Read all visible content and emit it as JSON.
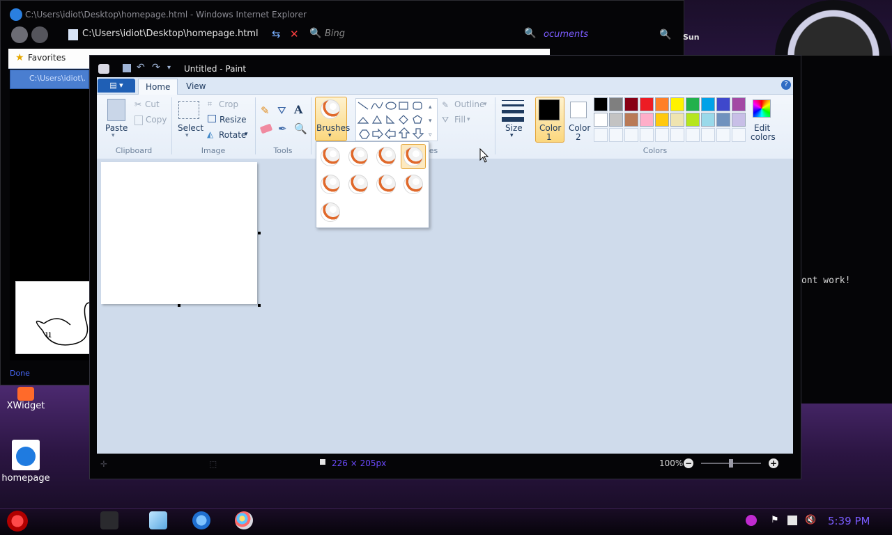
{
  "ie": {
    "title": "C:\\Users\\idiot\\Desktop\\homepage.html - Windows Internet Explorer",
    "address": "C:\\Users\\idiot\\Desktop\\homepage.html",
    "search_placeholder": "Bing",
    "favorites_label": "Favorites",
    "tab_label": "C:\\Users\\idiot\\...",
    "status": "Done"
  },
  "background_panel": {
    "documents_link": "ocuments",
    "day_label": "Sun",
    "terminal_text": "ont work!",
    "clock_ampm": "PM"
  },
  "desktop": {
    "icons": [
      {
        "label": "XWidget"
      },
      {
        "label": "homepage"
      }
    ]
  },
  "paint": {
    "title": "Untitled - Paint",
    "tabs": [
      {
        "label": "Home",
        "active": true
      },
      {
        "label": "View",
        "active": false
      }
    ],
    "clipboard": {
      "group": "Clipboard",
      "paste": "Paste",
      "cut": "Cut",
      "copy": "Copy"
    },
    "image": {
      "group": "Image",
      "select": "Select",
      "crop": "Crop",
      "resize": "Resize",
      "rotate": "Rotate"
    },
    "tools": {
      "group": "Tools"
    },
    "brushes": {
      "label": "Brushes"
    },
    "shapes": {
      "group_fragment": "es",
      "outline": "Outline",
      "fill": "Fill"
    },
    "size": {
      "label": "Size"
    },
    "color1": {
      "label": "Color",
      "num": "1"
    },
    "color2": {
      "label": "Color",
      "num": "2"
    },
    "colors": {
      "group": "Colors",
      "edit_label_1": "Edit",
      "edit_label_2": "colors",
      "row1": [
        "#000000",
        "#7f7f7f",
        "#880015",
        "#ed1c24",
        "#ff7f27",
        "#fff200",
        "#22b14c",
        "#00a2e8",
        "#3f48cc",
        "#a349a4"
      ],
      "row2": [
        "#ffffff",
        "#c3c3c3",
        "#b97a57",
        "#ffaec9",
        "#ffc90e",
        "#efe4b0",
        "#b5e61d",
        "#99d9ea",
        "#7092be",
        "#c8bfe7"
      ]
    },
    "status": {
      "dimensions": "226 × 205px",
      "zoom": "100%"
    }
  },
  "taskbar": {
    "clock": "5:39 PM"
  }
}
